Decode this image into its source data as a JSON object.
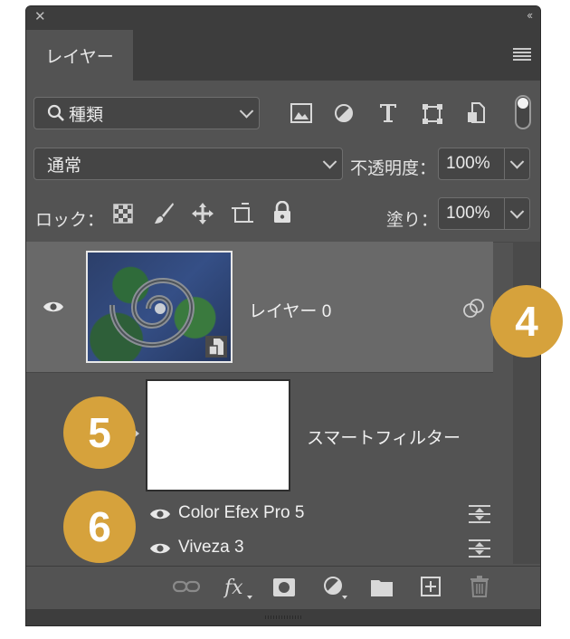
{
  "panel": {
    "tab_label": "レイヤー",
    "close_glyph": "✕",
    "collapse_glyph": "‹‹"
  },
  "filter": {
    "selected": "種類",
    "toggle_on": true
  },
  "blend": {
    "mode": "通常",
    "opacity_label": "不透明度：",
    "opacity_value": "100%"
  },
  "lock": {
    "label": "ロック：",
    "fill_label": "塗り：",
    "fill_value": "100%"
  },
  "layers": [
    {
      "name": "レイヤー 0",
      "visible": true,
      "smart_object": true
    }
  ],
  "smart_filters": {
    "label": "スマートフィルター",
    "items": [
      {
        "name": "Color Efex Pro 5",
        "visible": true
      },
      {
        "name": "Viveza 3",
        "visible": true
      }
    ]
  },
  "badges": [
    "4",
    "5",
    "6"
  ],
  "colors": {
    "panel_bg": "#535353",
    "header_bg": "#3d3d3d",
    "selected_row": "#696969",
    "badge": "#d6a23c"
  }
}
